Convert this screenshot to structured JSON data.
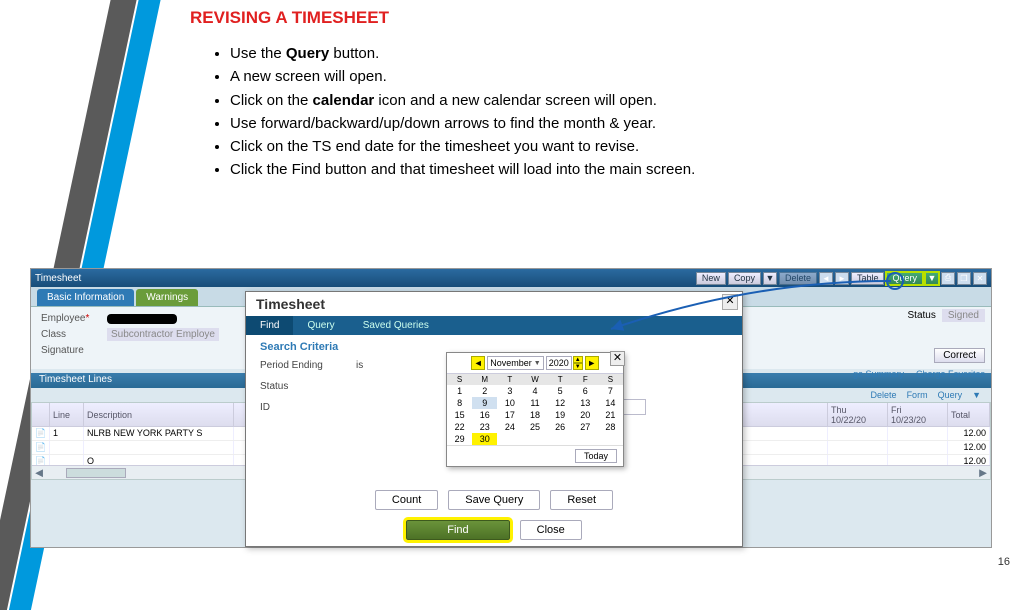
{
  "page_number": "16",
  "title": "REVISING A TIMESHEET",
  "bullets": [
    {
      "pre": "Use the ",
      "bold": "Query",
      "post": " button."
    },
    {
      "pre": "A new screen will open.",
      "bold": "",
      "post": ""
    },
    {
      "pre": "Click on the ",
      "bold": "calendar",
      "post": " icon and a new calendar screen will open."
    },
    {
      "pre": "Use forward/backward/up/down arrows to find the month & year.",
      "bold": "",
      "post": ""
    },
    {
      "pre": "Click on the TS end date for the timesheet you want to revise.",
      "bold": "",
      "post": ""
    },
    {
      "pre": "Click the Find button and that timesheet will load into the main screen.",
      "bold": "",
      "post": ""
    }
  ],
  "app": {
    "title": "Timesheet",
    "toolbar": {
      "new": "New",
      "copy": "Copy",
      "delete": "Delete",
      "table": "Table",
      "query": "Query"
    },
    "tabs": {
      "basic": "Basic Information",
      "warnings": "Warnings"
    },
    "form": {
      "employee_label": "Employee",
      "class_label": "Class",
      "class_value": "Subcontractor Employe",
      "signature_label": "Signature",
      "status_label": "Status",
      "status_value": "Signed",
      "correct": "Correct",
      "summary_tab": "ge Summary",
      "fav_tab": "Charge Favorites"
    },
    "lines": {
      "header": "Timesheet Lines",
      "right_tools": {
        "delete": "Delete",
        "form": "Form",
        "query": "Query"
      },
      "cols": {
        "line": "Line",
        "desc": "Description",
        "thu": "Thu",
        "thu_date": "10/22/20",
        "fri": "Fri",
        "fri_date": "10/23/20",
        "total": "Total"
      },
      "rows": [
        {
          "line": "1",
          "desc": "NLRB NEW YORK PARTY S",
          "total": "12.00"
        },
        {
          "line": "",
          "desc": "",
          "total": "12.00"
        },
        {
          "line": "",
          "desc": "O",
          "total": "12.00"
        }
      ]
    }
  },
  "modal": {
    "title": "Timesheet",
    "tabs": {
      "find": "Find",
      "query": "Query",
      "saved": "Saved Queries"
    },
    "criteria_title": "Search Criteria",
    "fields": {
      "period": "Period Ending",
      "period_op": "is",
      "status": "Status",
      "id": "ID"
    },
    "buttons": {
      "count": "Count",
      "save": "Save Query",
      "reset": "Reset",
      "find": "Find",
      "close": "Close"
    }
  },
  "calendar": {
    "month": "November",
    "year": "2020",
    "dow": [
      "S",
      "M",
      "T",
      "W",
      "T",
      "F",
      "S"
    ],
    "weeks": [
      [
        "1",
        "2",
        "3",
        "4",
        "5",
        "6",
        "7"
      ],
      [
        "8",
        "9",
        "10",
        "11",
        "12",
        "13",
        "14"
      ],
      [
        "15",
        "16",
        "17",
        "18",
        "19",
        "20",
        "21"
      ],
      [
        "22",
        "23",
        "24",
        "25",
        "26",
        "27",
        "28"
      ],
      [
        "29",
        "30",
        "",
        "",
        "",
        "",
        ""
      ]
    ],
    "highlight": [
      [
        "4",
        "1"
      ],
      [
        "1",
        "1"
      ]
    ],
    "today": "Today"
  }
}
